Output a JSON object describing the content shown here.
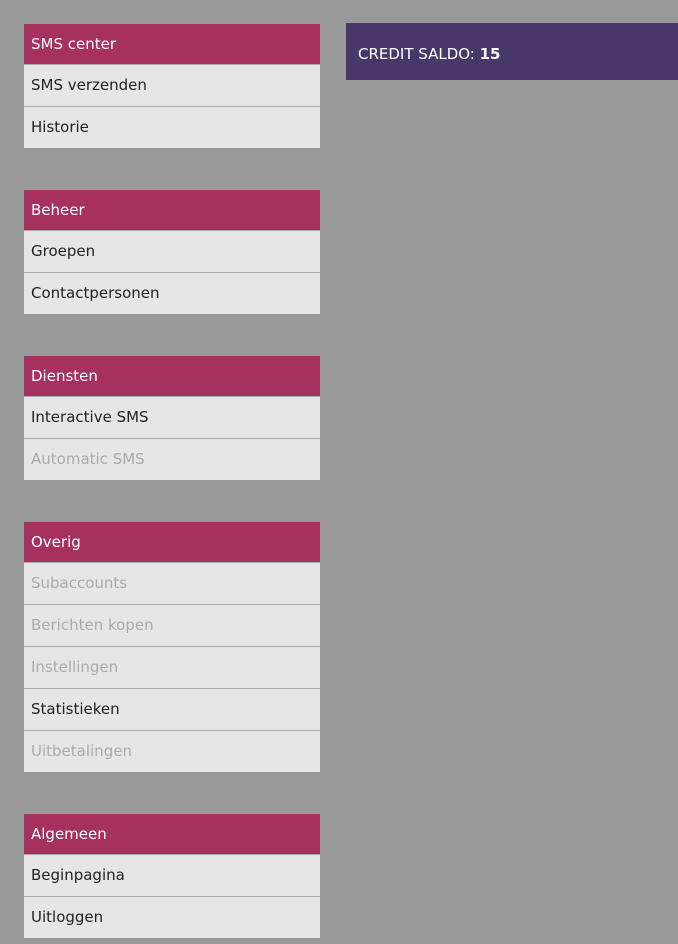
{
  "sidebar": {
    "groups": [
      {
        "header": "SMS center",
        "items": [
          {
            "label": "SMS verzenden",
            "enabled": true
          },
          {
            "label": "Historie",
            "enabled": true
          }
        ]
      },
      {
        "header": "Beheer",
        "items": [
          {
            "label": "Groepen",
            "enabled": true
          },
          {
            "label": "Contactpersonen",
            "enabled": true
          }
        ]
      },
      {
        "header": "Diensten",
        "items": [
          {
            "label": "Interactive SMS",
            "enabled": true
          },
          {
            "label": "Automatic SMS",
            "enabled": false
          }
        ]
      },
      {
        "header": "Overig",
        "items": [
          {
            "label": "Subaccounts",
            "enabled": false
          },
          {
            "label": "Berichten kopen",
            "enabled": false
          },
          {
            "label": "Instellingen",
            "enabled": false
          },
          {
            "label": "Statistieken",
            "enabled": true
          },
          {
            "label": "Uitbetalingen",
            "enabled": false
          }
        ]
      },
      {
        "header": "Algemeen",
        "items": [
          {
            "label": "Beginpagina",
            "enabled": true
          },
          {
            "label": "Uitloggen",
            "enabled": true
          }
        ]
      }
    ]
  },
  "credit": {
    "label": "CREDIT SALDO:",
    "value": "15"
  },
  "colors": {
    "background": "#999999",
    "group_header": "#a6305e",
    "menu_item": "#e6e6e6",
    "menu_item_disabled_text": "#aaaaaa",
    "credit_panel": "#48386a"
  }
}
